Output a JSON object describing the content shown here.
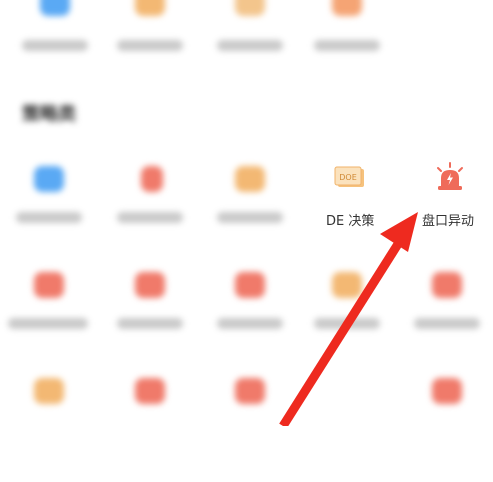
{
  "section": {
    "title": "策略类"
  },
  "tools": {
    "doe": {
      "label": "DE 决策",
      "icon": "doe-document-icon",
      "icon_text": "DOE"
    },
    "alert": {
      "label": "盘口异动",
      "icon": "alarm-siren-icon"
    }
  },
  "colors": {
    "blue": "#5aa9f4",
    "orange": "#f3b873",
    "red": "#f07a6a",
    "arrow": "#ee2a1f",
    "label_text": "#333333"
  }
}
